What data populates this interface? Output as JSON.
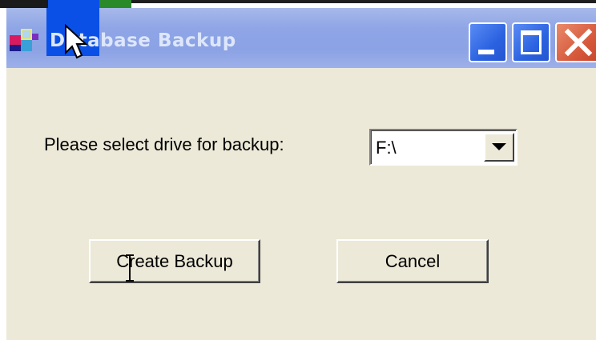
{
  "window": {
    "title": "Database Backup",
    "icon": "app-icon",
    "controls": {
      "minimize": "minimize-icon",
      "maximize": "maximize-icon",
      "close": "close-icon"
    }
  },
  "form": {
    "drive_label": "Please select drive for backup:",
    "drive_select": {
      "selected": "F:\\",
      "icon": "chevron-down-icon"
    },
    "create_button": "Create Backup",
    "cancel_button": "Cancel"
  },
  "colors": {
    "titlebar": "#8ea5e6",
    "title_text": "#dde6fb",
    "client_bg": "#ece9d8",
    "close_button": "#d7593c",
    "control_buttons": "#2b62e0"
  }
}
